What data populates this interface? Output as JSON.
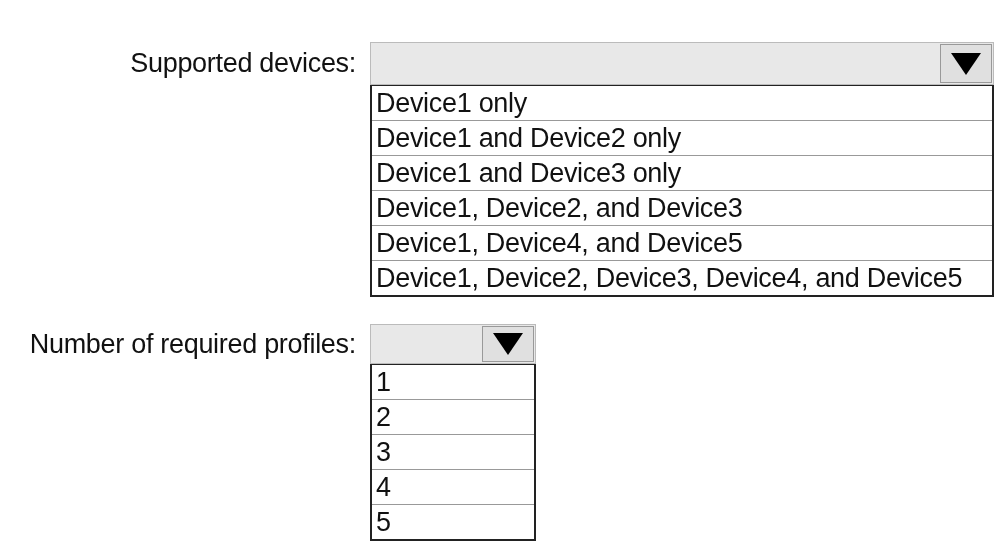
{
  "questions": [
    {
      "label": "Supported devices:",
      "options": [
        "Device1 only",
        "Device1 and Device2 only",
        "Device1 and Device3 only",
        "Device1, Device2, and Device3",
        "Device1, Device4, and Device5",
        "Device1, Device2, Device3, Device4, and Device5"
      ]
    },
    {
      "label": "Number of required profiles:",
      "options": [
        "1",
        "2",
        "3",
        "4",
        "5"
      ]
    }
  ]
}
